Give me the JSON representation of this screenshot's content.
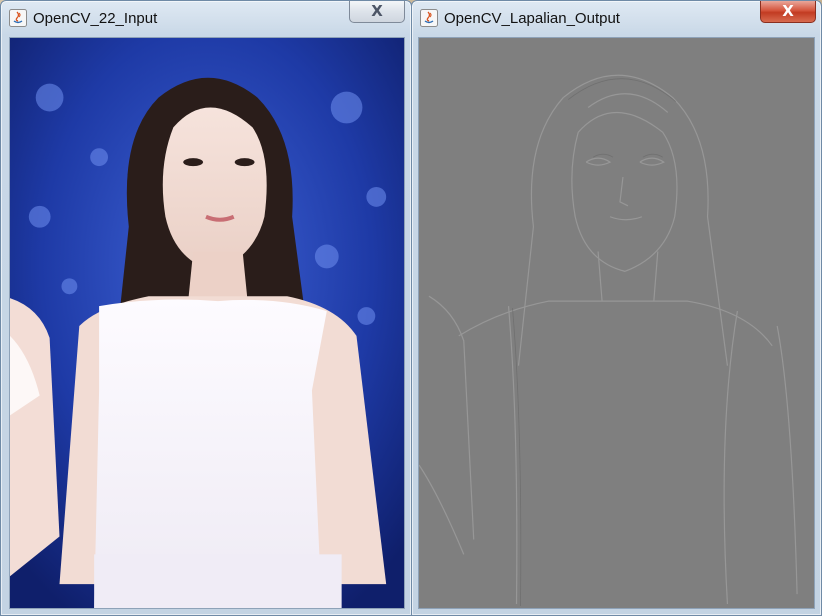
{
  "windows": {
    "input": {
      "title": "OpenCV_22_Input",
      "icon": "java-icon",
      "close_label": "X"
    },
    "output": {
      "title": "OpenCV_Lapalian_Output",
      "icon": "java-icon",
      "close_label": "X"
    }
  },
  "colors": {
    "background_blue": "#1d3aa8",
    "hair": "#2a1d1a",
    "skin": "#f1d9cf",
    "dress": "#f8f6fb",
    "laplacian_gray": "#7f7f7f"
  }
}
